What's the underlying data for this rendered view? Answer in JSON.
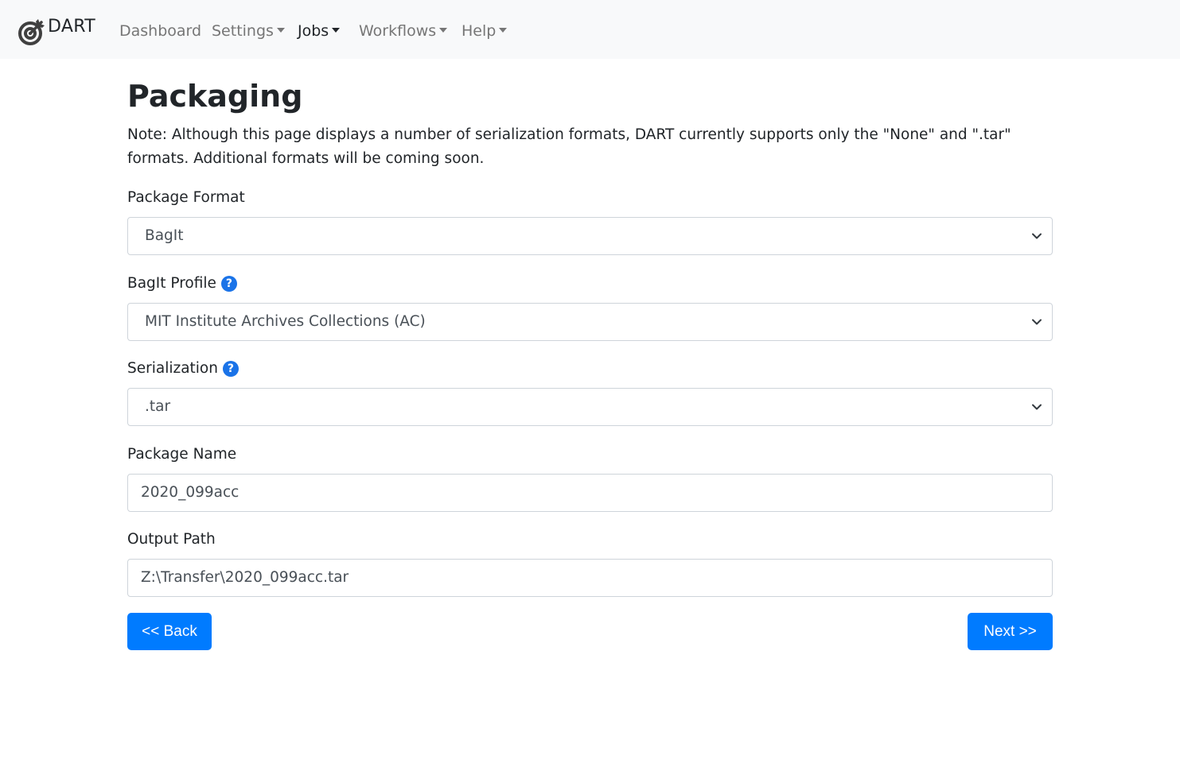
{
  "brand": {
    "name": "DART",
    "icon": "target-arrow-icon"
  },
  "nav": {
    "items": [
      {
        "label": "Dashboard",
        "dropdown": false,
        "active": false
      },
      {
        "label": "Settings",
        "dropdown": true,
        "active": false
      },
      {
        "label": "Jobs",
        "dropdown": true,
        "active": true
      },
      {
        "label": "Workflows",
        "dropdown": true,
        "active": false
      },
      {
        "label": "Help",
        "dropdown": true,
        "active": false
      }
    ]
  },
  "page": {
    "title": "Packaging",
    "note": "Note: Although this page displays a number of serialization formats, DART currently supports only the \"None\" and \".tar\" formats. Additional formats will be coming soon."
  },
  "form": {
    "package_format": {
      "label": "Package Format",
      "value": "BagIt"
    },
    "bagit_profile": {
      "label": "BagIt Profile",
      "value": "MIT Institute Archives Collections (AC)",
      "help_icon": "question-circle-icon"
    },
    "serialization": {
      "label": "Serialization",
      "value": ".tar",
      "help_icon": "question-circle-icon"
    },
    "package_name": {
      "label": "Package Name",
      "value": "2020_099acc"
    },
    "output_path": {
      "label": "Output Path",
      "value": "Z:\\Transfer\\2020_099acc.tar"
    }
  },
  "buttons": {
    "back": "<< Back",
    "next": "Next >>"
  },
  "colors": {
    "primary": "#007bff",
    "navbar_bg": "#f8f9fa",
    "help_icon": "#1a73e8",
    "nav_text": "#767676",
    "active_nav": "#212529"
  }
}
